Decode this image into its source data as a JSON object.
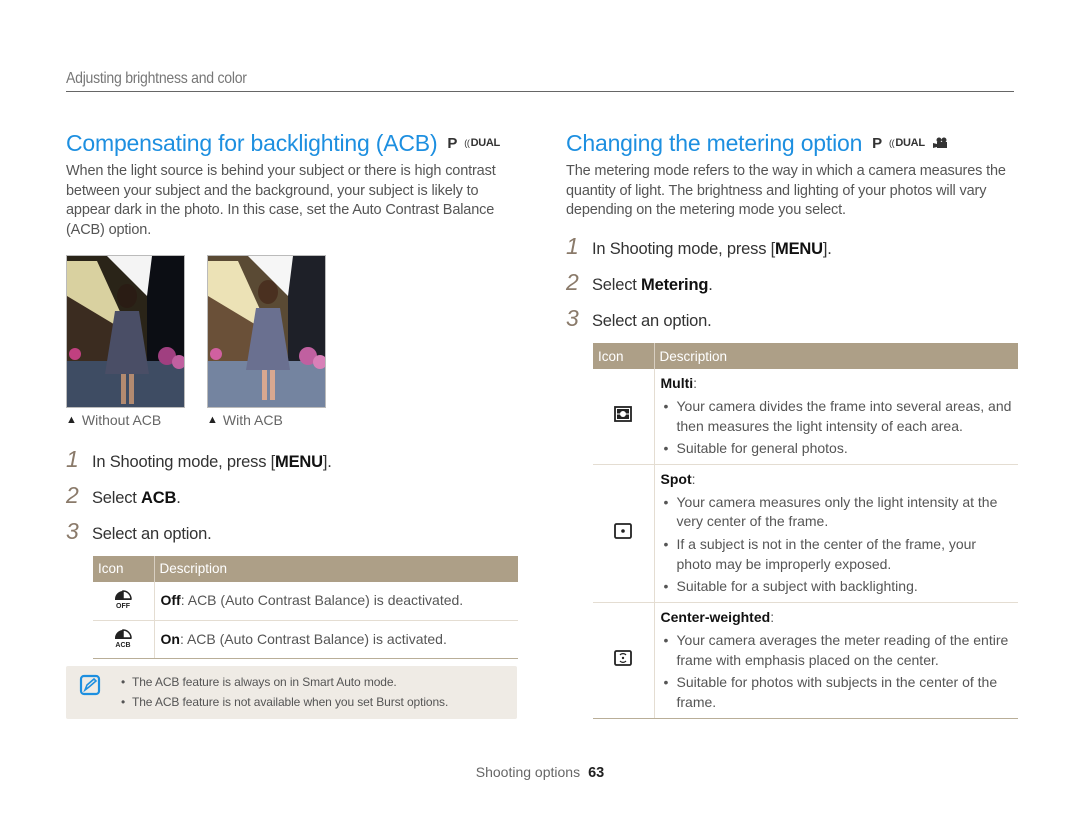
{
  "breadcrumb": "Adjusting brightness and color",
  "left": {
    "title": "Compensating for backlighting (ACB)",
    "modes": [
      "P",
      "DUAL"
    ],
    "intro": "When the light source is behind your subject or there is high contrast between your subject and the background, your subject is likely to appear dark in the photo. In this case, set the Auto Contrast Balance (ACB) option.",
    "photos": [
      {
        "caption": "Without ACB",
        "icon": "triangle-up-icon"
      },
      {
        "caption": "With ACB",
        "icon": "triangle-up-icon"
      }
    ],
    "steps": [
      {
        "num": "1",
        "pre": "In Shooting mode, press [",
        "bold": "MENU",
        "post": "]."
      },
      {
        "num": "2",
        "pre": "Select ",
        "bold": "ACB",
        "post": "."
      },
      {
        "num": "3",
        "pre": "Select an option.",
        "bold": "",
        "post": ""
      }
    ],
    "table": {
      "headers": [
        "Icon",
        "Description"
      ],
      "rows": [
        {
          "icon": "acb-off-icon",
          "name": "Off",
          "desc": ": ACB (Auto Contrast Balance) is deactivated."
        },
        {
          "icon": "acb-on-icon",
          "name": "On",
          "desc": ": ACB (Auto Contrast Balance) is activated."
        }
      ]
    },
    "note": {
      "icon": "note-pencil-icon",
      "items": [
        "The ACB feature is always on in Smart Auto mode.",
        "The ACB feature is not available when you set Burst options."
      ]
    }
  },
  "right": {
    "title": "Changing the metering option",
    "modes": [
      "P",
      "DUAL",
      "MOVIE"
    ],
    "intro": "The metering mode refers to the way in which a camera measures the quantity of light. The brightness and lighting of your photos will vary depending on the metering mode you select.",
    "steps": [
      {
        "num": "1",
        "pre": "In Shooting mode, press [",
        "bold": "MENU",
        "post": "]."
      },
      {
        "num": "2",
        "pre": "Select ",
        "bold": "Metering",
        "post": "."
      },
      {
        "num": "3",
        "pre": "Select an option.",
        "bold": "",
        "post": ""
      }
    ],
    "table": {
      "headers": [
        "Icon",
        "Description"
      ],
      "rows": [
        {
          "icon": "multi-metering-icon",
          "name": "Multi",
          "bullets": [
            "Your camera divides the frame into several areas, and then measures the light intensity of each area.",
            "Suitable for general photos."
          ]
        },
        {
          "icon": "spot-metering-icon",
          "name": "Spot",
          "bullets": [
            "Your camera measures only the light intensity at the very center of the frame.",
            "If a subject is not in the center of the frame, your photo may be improperly exposed.",
            "Suitable for a subject with backlighting."
          ]
        },
        {
          "icon": "center-weighted-metering-icon",
          "name": "Center-weighted",
          "bullets": [
            "Your camera averages the meter reading of the entire frame with emphasis placed on the center.",
            "Suitable for photos with subjects in the center of the frame."
          ]
        }
      ]
    }
  },
  "footer": {
    "section": "Shooting options",
    "page": "63"
  },
  "colors": {
    "title_blue": "#1d8fe0",
    "table_header": "#ad9f87",
    "note_bg": "#efebe5",
    "note_icon": "#1d8fe0"
  }
}
